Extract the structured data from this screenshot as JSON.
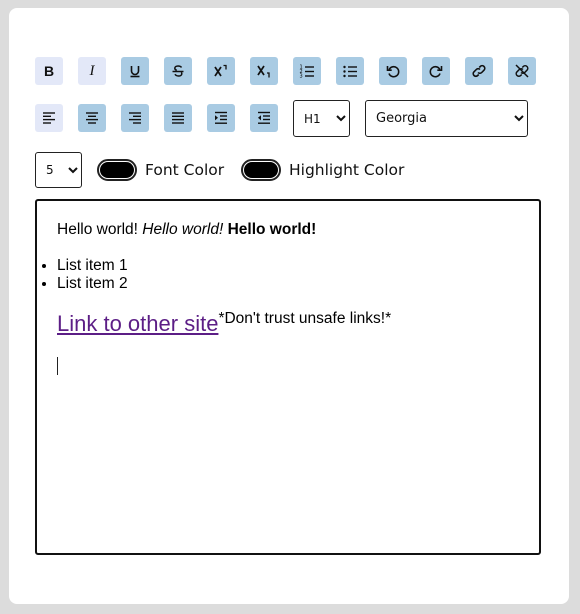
{
  "toolbar": {
    "format_buttons": [
      {
        "name": "bold-button",
        "icon": "bold-icon",
        "style": "light",
        "text": "B"
      },
      {
        "name": "italic-button",
        "icon": "italic-icon",
        "style": "light",
        "text": "I"
      },
      {
        "name": "underline-button",
        "icon": "underline-icon",
        "style": "dark"
      },
      {
        "name": "strikethrough-button",
        "icon": "strikethrough-icon",
        "style": "dark"
      },
      {
        "name": "superscript-button",
        "icon": "superscript-icon",
        "style": "dark"
      },
      {
        "name": "subscript-button",
        "icon": "subscript-icon",
        "style": "dark"
      },
      {
        "name": "ordered-list-button",
        "icon": "ordered-list-icon",
        "style": "dark"
      },
      {
        "name": "unordered-list-button",
        "icon": "unordered-list-icon",
        "style": "dark"
      },
      {
        "name": "undo-button",
        "icon": "undo-icon",
        "style": "dark"
      },
      {
        "name": "redo-button",
        "icon": "redo-icon",
        "style": "dark"
      },
      {
        "name": "link-button",
        "icon": "link-icon",
        "style": "dark"
      },
      {
        "name": "unlink-button",
        "icon": "unlink-icon",
        "style": "dark"
      }
    ],
    "align_buttons": [
      {
        "name": "align-left-button",
        "icon": "align-left-icon",
        "style": "light"
      },
      {
        "name": "align-center-button",
        "icon": "align-center-icon",
        "style": "dark"
      },
      {
        "name": "align-right-button",
        "icon": "align-right-icon",
        "style": "dark"
      },
      {
        "name": "justify-button",
        "icon": "justify-icon",
        "style": "dark"
      },
      {
        "name": "indent-button",
        "icon": "indent-icon",
        "style": "dark"
      },
      {
        "name": "outdent-button",
        "icon": "outdent-icon",
        "style": "dark"
      }
    ],
    "heading_select": {
      "selected": "H1"
    },
    "font_select": {
      "selected": "Georgia"
    },
    "size_select": {
      "selected": "5"
    },
    "font_color_label": "Font Color",
    "highlight_color_label": "Highlight Color",
    "font_color_value": "#000000",
    "highlight_color_value": "#000000",
    "light_button_color": "#e3e8f8",
    "dark_button_color": "#a9cbe3"
  },
  "editor": {
    "line1": {
      "plain": "Hello world!",
      "italic": "Hello world!",
      "bold": "Hello world!"
    },
    "list_items": [
      "List item 1",
      "List item 2"
    ],
    "link_text": "Link to other site",
    "link_color": "#5c1e86",
    "warning_text": "*Don't trust unsafe links!*"
  }
}
